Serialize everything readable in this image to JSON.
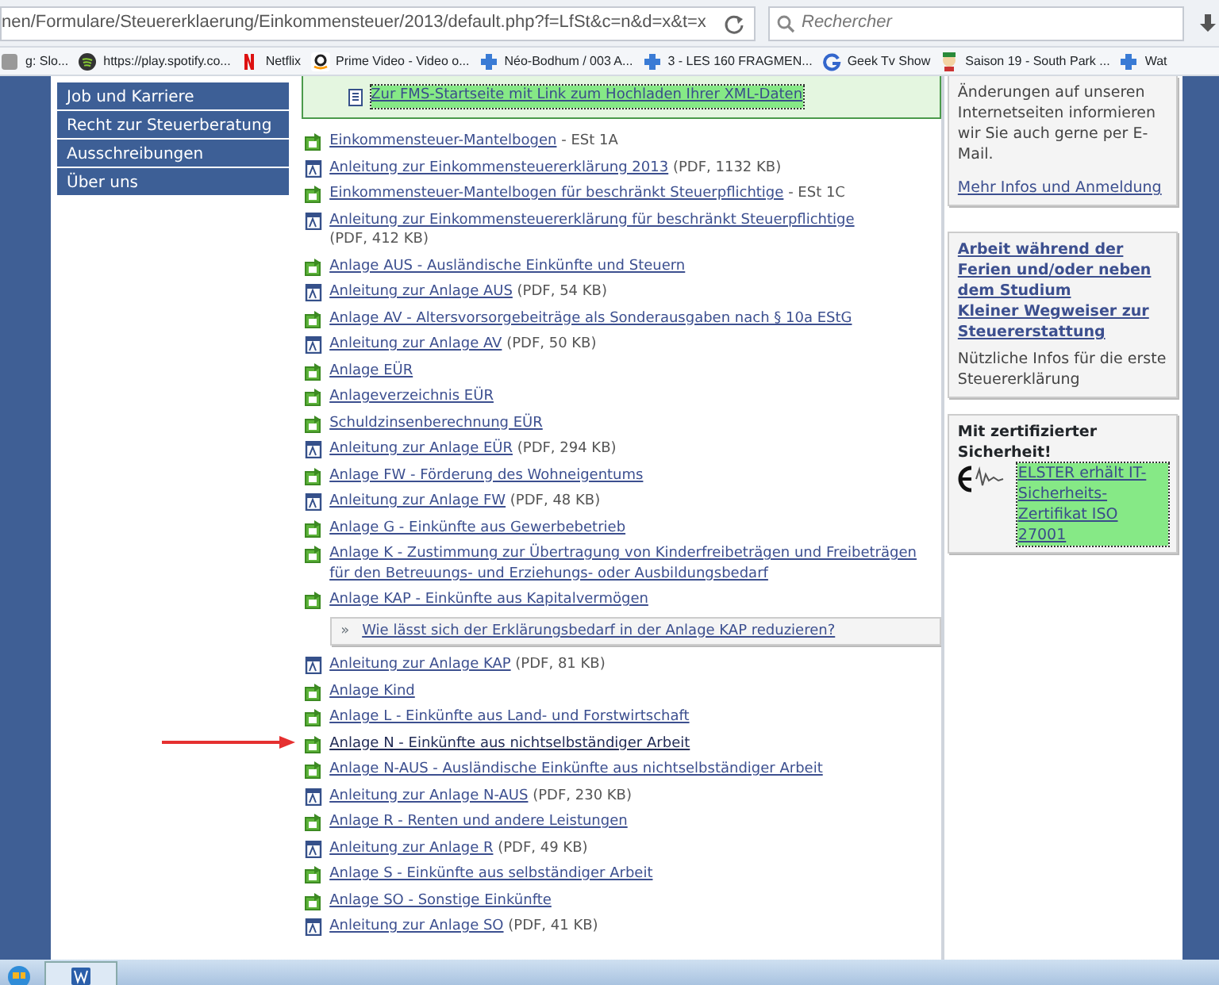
{
  "browser": {
    "url": "nen/Formulare/Steuererklaerung/Einkommensteuer/2013/default.php?f=LfSt&c=n&d=x&t=x",
    "search_placeholder": "Rechercher",
    "bookmarks": [
      {
        "kind": "generic",
        "label": "g: Slo..."
      },
      {
        "kind": "spotify",
        "label": "https://play.spotify.co..."
      },
      {
        "kind": "netflix",
        "label": "Netflix"
      },
      {
        "kind": "amazon",
        "label": "Prime Video - Video o..."
      },
      {
        "kind": "puzzle",
        "label": "Néo-Bodhum / 003 A..."
      },
      {
        "kind": "puzzle",
        "label": "3 - LES 160 FRAGMEN..."
      },
      {
        "kind": "google",
        "label": "Geek Tv Show"
      },
      {
        "kind": "cartoon",
        "label": "Saison 19 - South Park ..."
      },
      {
        "kind": "puzzle",
        "label": "Wat"
      }
    ]
  },
  "nav": {
    "items": [
      "Job und Karriere",
      "Recht zur Steuerberatung",
      "Ausschreibungen",
      "Über uns"
    ]
  },
  "upload_box": {
    "link": "Zur FMS-Startseite mit Link zum Hochladen Ihrer XML-Daten"
  },
  "downloads": [
    {
      "kind": "form",
      "link": "Einkommensteuer-Mantelbogen",
      "suffix": "- ESt 1A",
      "marked": false
    },
    {
      "kind": "pdf",
      "link": "Anleitung zur Einkommensteuererklärung 2013",
      "suffix": "(PDF, 1132 KB)",
      "marked": false
    },
    {
      "kind": "form",
      "link": "Einkommensteuer-Mantelbogen für beschränkt Steuerpflichtige",
      "suffix": "- ESt 1C",
      "marked": false
    },
    {
      "kind": "pdf",
      "link": "Anleitung zur Einkommensteuererklärung für beschränkt Steuerpflichtige",
      "suffix": "(PDF, 412 KB)",
      "marked": false
    },
    {
      "kind": "form",
      "link": "Anlage AUS - Ausländische Einkünfte und Steuern",
      "marked": false
    },
    {
      "kind": "pdf",
      "link": "Anleitung zur Anlage AUS",
      "suffix": "(PDF, 54 KB)",
      "marked": false
    },
    {
      "kind": "form",
      "link": "Anlage AV - Altersvorsorgebeiträge als Sonderausgaben nach § 10a EStG",
      "marked": false
    },
    {
      "kind": "pdf",
      "link": "Anleitung zur Anlage AV",
      "suffix": "(PDF, 50 KB)",
      "marked": false
    },
    {
      "kind": "form",
      "link": "Anlage EÜR",
      "marked": false
    },
    {
      "kind": "form",
      "link": "Anlageverzeichnis EÜR",
      "marked": false
    },
    {
      "kind": "form",
      "link": "Schuldzinsenberechnung EÜR",
      "marked": false
    },
    {
      "kind": "pdf",
      "link": "Anleitung zur Anlage EÜR",
      "suffix": "(PDF, 294 KB)",
      "marked": false
    },
    {
      "kind": "form",
      "link": "Anlage FW - Förderung des Wohneigentums",
      "marked": false
    },
    {
      "kind": "pdf",
      "link": "Anleitung zur Anlage FW",
      "suffix": "(PDF, 48 KB)",
      "marked": false
    },
    {
      "kind": "form",
      "link": "Anlage G - Einkünfte aus Gewerbebetrieb",
      "marked": false
    },
    {
      "kind": "form",
      "link": "Anlage K - Zustimmung zur Übertragung von Kinderfreibeträgen und Freibeträgen für den Betreuungs- und Erziehungs- oder Ausbildungsbedarf",
      "marked": false
    },
    {
      "kind": "form",
      "link": "Anlage KAP - Einkünfte aus Kapitalvermögen",
      "marked": false
    },
    {
      "kind": "note",
      "bullet": "»",
      "link": "Wie lässt sich der Erklärungsbedarf in der Anlage KAP reduzieren?",
      "marked": false
    },
    {
      "kind": "pdf",
      "link": "Anleitung zur Anlage KAP",
      "suffix": "(PDF, 81 KB)",
      "marked": false
    },
    {
      "kind": "form",
      "link": "Anlage Kind",
      "marked": false
    },
    {
      "kind": "form",
      "link": "Anlage L - Einkünfte aus Land- und Forstwirtschaft",
      "marked": false
    },
    {
      "kind": "form",
      "link": "Anlage N - Einkünfte aus nichtselbständiger Arbeit",
      "marked": true
    },
    {
      "kind": "form",
      "link": "Anlage N-AUS - Ausländische Einkünfte aus nichtselbständiger Arbeit",
      "marked": false
    },
    {
      "kind": "pdf",
      "link": "Anleitung zur Anlage N-AUS",
      "suffix": "(PDF, 230 KB)",
      "marked": false
    },
    {
      "kind": "form",
      "link": "Anlage R - Renten und andere Leistungen",
      "marked": false
    },
    {
      "kind": "pdf",
      "link": "Anleitung zur Anlage R",
      "suffix": "(PDF, 49 KB)",
      "marked": false
    },
    {
      "kind": "form",
      "link": "Anlage S - Einkünfte aus selbständiger Arbeit",
      "marked": false
    },
    {
      "kind": "form",
      "link": "Anlage SO - Sonstige Einkünfte",
      "marked": false
    },
    {
      "kind": "pdf",
      "link": "Anleitung zur Anlage SO",
      "suffix": "(PDF, 41 KB)",
      "marked": false
    }
  ],
  "sidebar": {
    "panels": [
      {
        "kind": "newsletter",
        "text": "Änderungen auf unseren Internetseiten informieren wir Sie auch gerne per E-Mail.",
        "link": "Mehr Infos und Anmeldung"
      },
      {
        "kind": "tips",
        "links": [
          "Arbeit während der Ferien und/oder neben dem Studium",
          "Kleiner Wegweiser zur Steuererstattung"
        ],
        "text": "Nützliche Infos für die erste Steuererklärung"
      },
      {
        "kind": "security",
        "heading": "Mit zertifizierter Sicherheit!",
        "link": "ELSTER erhält IT-Sicherheits-Zertifikat ISO 27001"
      }
    ]
  }
}
